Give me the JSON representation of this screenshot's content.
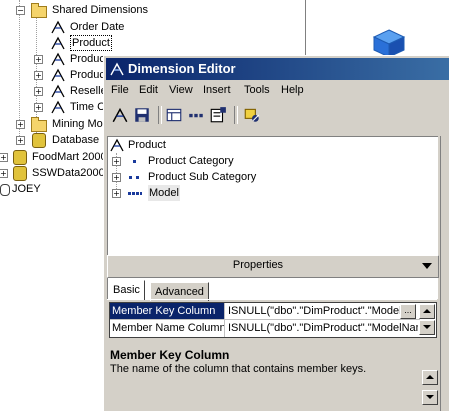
{
  "tree": {
    "shared_dimensions": "Shared Dimensions",
    "order_date": "Order Date",
    "product": "Product",
    "produc1": "Produc",
    "produc2": "Produc",
    "reselle": "Reselle",
    "time_c": "Time C",
    "mining_mod": "Mining Mod",
    "database": "Database",
    "foodmart": "FoodMart 2000",
    "sswdata": "SSWData2000",
    "joey": "JOEY"
  },
  "dialog": {
    "title": "Dimension Editor",
    "menu": [
      "File",
      "Edit",
      "View",
      "Insert",
      "Tools",
      "Help"
    ],
    "toolbar_icons": [
      "dimension-icon",
      "save-icon",
      "table-view-icon",
      "member-grid-icon",
      "properties-icon",
      "process-icon"
    ],
    "pane_tree": {
      "root": "Product",
      "levels": [
        "Product Category",
        "Product Sub Category",
        "Model"
      ]
    },
    "properties_label": "Properties",
    "tabs": [
      "Basic",
      "Advanced"
    ],
    "grid": [
      {
        "name": "Member Key Column",
        "value": "ISNULL(\"dbo\".\"DimProduct\".\"ModelN"
      },
      {
        "name": "Member Name Column",
        "value": "ISNULL(\"dbo\".\"DimProduct\".\"ModelNam"
      }
    ],
    "ellipsis": "...",
    "description": {
      "title": "Member Key Column",
      "text": "The name of the column that contains member keys."
    }
  },
  "colors": {
    "titlebar_start": "#0a246a",
    "titlebar_end": "#3a6ea5",
    "dialog_bg": "#d4d0c8",
    "selection": "#0a246a"
  }
}
